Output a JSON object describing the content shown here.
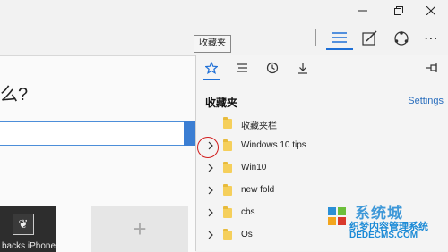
{
  "tooltip": "收藏夹",
  "page": {
    "question": "么?",
    "tile_label": "backs iPhone"
  },
  "hub": {
    "title": "收藏夹",
    "settings_label": "Settings",
    "items": [
      {
        "label": "收藏夹栏",
        "has_chevron": false
      },
      {
        "label": "Windows 10 tips",
        "has_chevron": true
      },
      {
        "label": "Win10",
        "has_chevron": true
      },
      {
        "label": "new fold",
        "has_chevron": true
      },
      {
        "label": "cbs",
        "has_chevron": true
      },
      {
        "label": "Os",
        "has_chevron": true
      }
    ]
  },
  "watermark": {
    "brand": "系统城",
    "line1": "织梦内容管理系统",
    "line2": "DEDECMS.COM"
  },
  "colors": {
    "accent": "#1e6fd6",
    "folder": "#f5cf5b",
    "annotation": "#d21c1c"
  }
}
